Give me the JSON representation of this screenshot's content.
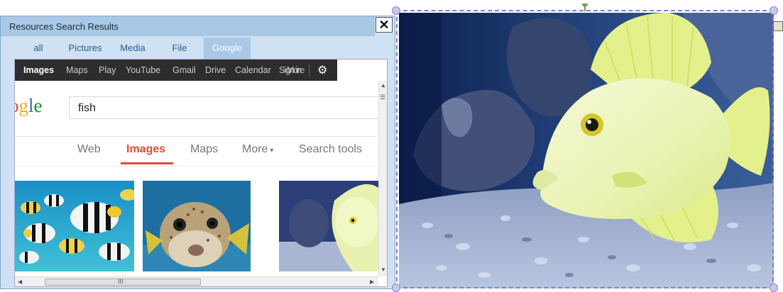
{
  "panel": {
    "title": "Resources Search Results",
    "close_label": "✕",
    "tabs": [
      {
        "label": "all",
        "selected": false
      },
      {
        "label": "Pictures",
        "selected": false
      },
      {
        "label": "Media",
        "selected": false
      },
      {
        "label": "File",
        "selected": false
      },
      {
        "label": "Google",
        "selected": true
      }
    ]
  },
  "google": {
    "bar_items": [
      "Images",
      "Maps",
      "Play",
      "YouTube",
      "Gmail",
      "Drive",
      "Calendar",
      "Sign in",
      "More"
    ],
    "logo_text": "ogle",
    "query": "fish",
    "nav": [
      "Web",
      "Images",
      "Maps",
      "More",
      "Search tools"
    ],
    "scroll_mark": "III"
  },
  "colors": {
    "selection": "#7b7bd6",
    "accent_red": "#dd4b39",
    "panel_header": "#a9c8e6"
  }
}
